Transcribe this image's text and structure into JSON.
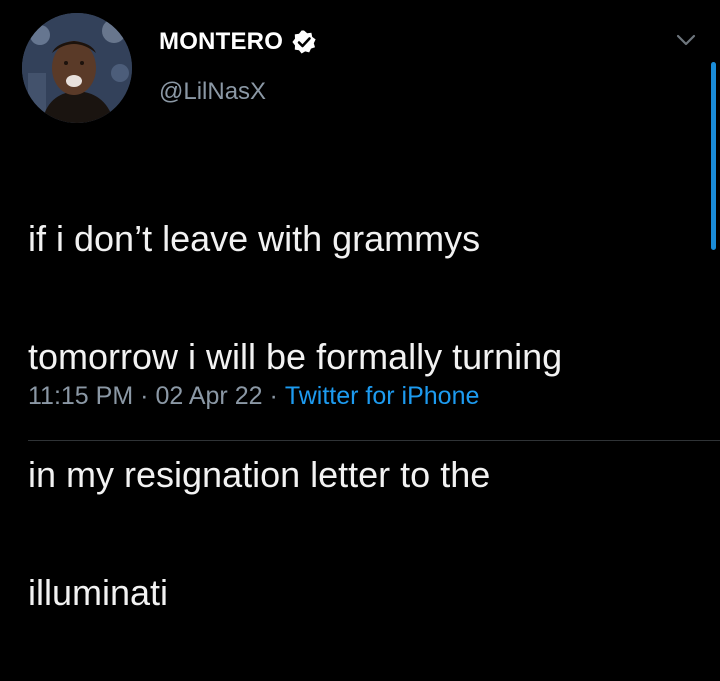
{
  "author": {
    "display_name": "MONTERO",
    "handle": "@LilNasX",
    "verified": true,
    "avatar_icon": "profile-photo"
  },
  "tweet": {
    "lines": [
      "if i don’t leave with grammys",
      "tomorrow i will be formally turning",
      "in my resignation letter to the",
      "illuminati"
    ]
  },
  "meta": {
    "time": "11:15 PM",
    "separator": "·",
    "date": "02 Apr 22",
    "source": "Twitter for iPhone"
  },
  "icons": {
    "verified": "verified-badge-icon",
    "menu": "chevron-down-icon"
  },
  "colors": {
    "background": "#000000",
    "text": "#f2f2f2",
    "secondary": "#8b98a5",
    "link": "#1d9bf0"
  }
}
